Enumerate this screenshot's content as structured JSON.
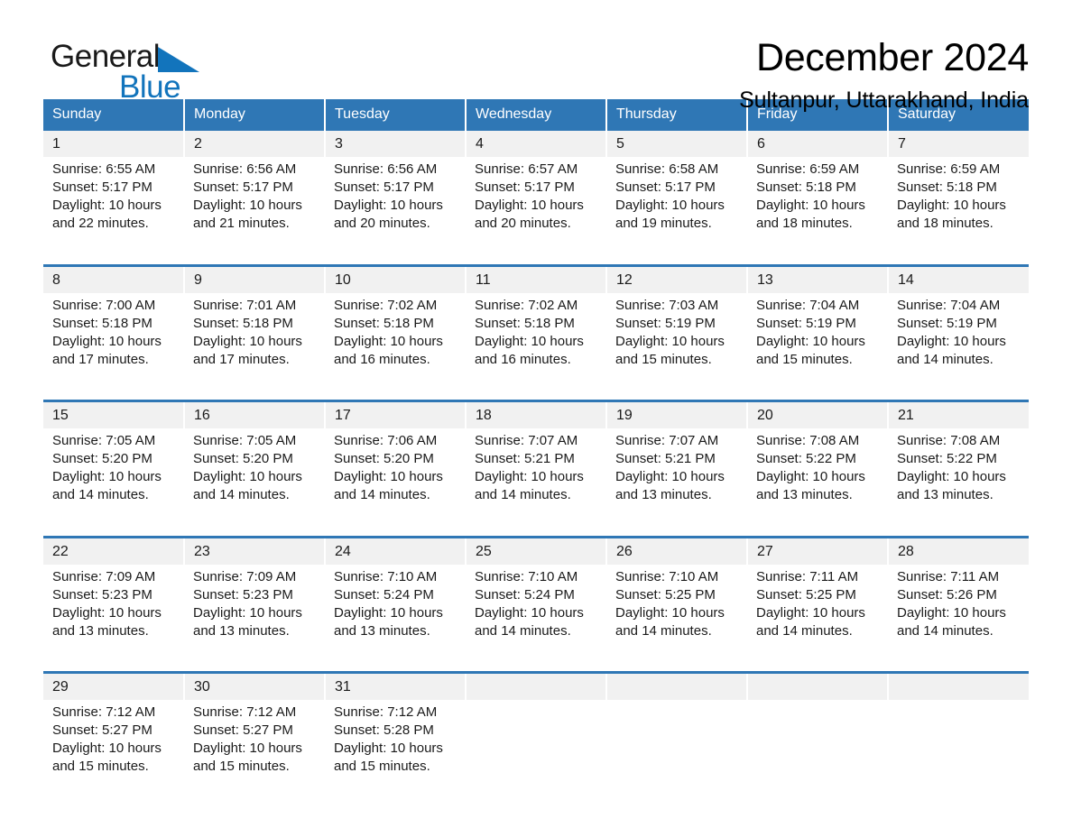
{
  "brand": {
    "word_one": "General",
    "word_two": "Blue",
    "triangle_color": "#1274bc"
  },
  "header": {
    "month_title": "December 2024",
    "location": "Sultanpur, Uttarakhand, India"
  },
  "colors": {
    "header_blue": "#2f77b5",
    "band_gray": "#f1f1f1",
    "accent_blue": "#1274bc"
  },
  "calendar": {
    "weekday_headers": [
      "Sunday",
      "Monday",
      "Tuesday",
      "Wednesday",
      "Thursday",
      "Friday",
      "Saturday"
    ],
    "weeks": [
      {
        "days": [
          {
            "date": "1",
            "sunrise": "Sunrise: 6:55 AM",
            "sunset": "Sunset: 5:17 PM",
            "daylight_1": "Daylight: 10 hours",
            "daylight_2": "and 22 minutes."
          },
          {
            "date": "2",
            "sunrise": "Sunrise: 6:56 AM",
            "sunset": "Sunset: 5:17 PM",
            "daylight_1": "Daylight: 10 hours",
            "daylight_2": "and 21 minutes."
          },
          {
            "date": "3",
            "sunrise": "Sunrise: 6:56 AM",
            "sunset": "Sunset: 5:17 PM",
            "daylight_1": "Daylight: 10 hours",
            "daylight_2": "and 20 minutes."
          },
          {
            "date": "4",
            "sunrise": "Sunrise: 6:57 AM",
            "sunset": "Sunset: 5:17 PM",
            "daylight_1": "Daylight: 10 hours",
            "daylight_2": "and 20 minutes."
          },
          {
            "date": "5",
            "sunrise": "Sunrise: 6:58 AM",
            "sunset": "Sunset: 5:17 PM",
            "daylight_1": "Daylight: 10 hours",
            "daylight_2": "and 19 minutes."
          },
          {
            "date": "6",
            "sunrise": "Sunrise: 6:59 AM",
            "sunset": "Sunset: 5:18 PM",
            "daylight_1": "Daylight: 10 hours",
            "daylight_2": "and 18 minutes."
          },
          {
            "date": "7",
            "sunrise": "Sunrise: 6:59 AM",
            "sunset": "Sunset: 5:18 PM",
            "daylight_1": "Daylight: 10 hours",
            "daylight_2": "and 18 minutes."
          }
        ]
      },
      {
        "days": [
          {
            "date": "8",
            "sunrise": "Sunrise: 7:00 AM",
            "sunset": "Sunset: 5:18 PM",
            "daylight_1": "Daylight: 10 hours",
            "daylight_2": "and 17 minutes."
          },
          {
            "date": "9",
            "sunrise": "Sunrise: 7:01 AM",
            "sunset": "Sunset: 5:18 PM",
            "daylight_1": "Daylight: 10 hours",
            "daylight_2": "and 17 minutes."
          },
          {
            "date": "10",
            "sunrise": "Sunrise: 7:02 AM",
            "sunset": "Sunset: 5:18 PM",
            "daylight_1": "Daylight: 10 hours",
            "daylight_2": "and 16 minutes."
          },
          {
            "date": "11",
            "sunrise": "Sunrise: 7:02 AM",
            "sunset": "Sunset: 5:18 PM",
            "daylight_1": "Daylight: 10 hours",
            "daylight_2": "and 16 minutes."
          },
          {
            "date": "12",
            "sunrise": "Sunrise: 7:03 AM",
            "sunset": "Sunset: 5:19 PM",
            "daylight_1": "Daylight: 10 hours",
            "daylight_2": "and 15 minutes."
          },
          {
            "date": "13",
            "sunrise": "Sunrise: 7:04 AM",
            "sunset": "Sunset: 5:19 PM",
            "daylight_1": "Daylight: 10 hours",
            "daylight_2": "and 15 minutes."
          },
          {
            "date": "14",
            "sunrise": "Sunrise: 7:04 AM",
            "sunset": "Sunset: 5:19 PM",
            "daylight_1": "Daylight: 10 hours",
            "daylight_2": "and 14 minutes."
          }
        ]
      },
      {
        "days": [
          {
            "date": "15",
            "sunrise": "Sunrise: 7:05 AM",
            "sunset": "Sunset: 5:20 PM",
            "daylight_1": "Daylight: 10 hours",
            "daylight_2": "and 14 minutes."
          },
          {
            "date": "16",
            "sunrise": "Sunrise: 7:05 AM",
            "sunset": "Sunset: 5:20 PM",
            "daylight_1": "Daylight: 10 hours",
            "daylight_2": "and 14 minutes."
          },
          {
            "date": "17",
            "sunrise": "Sunrise: 7:06 AM",
            "sunset": "Sunset: 5:20 PM",
            "daylight_1": "Daylight: 10 hours",
            "daylight_2": "and 14 minutes."
          },
          {
            "date": "18",
            "sunrise": "Sunrise: 7:07 AM",
            "sunset": "Sunset: 5:21 PM",
            "daylight_1": "Daylight: 10 hours",
            "daylight_2": "and 14 minutes."
          },
          {
            "date": "19",
            "sunrise": "Sunrise: 7:07 AM",
            "sunset": "Sunset: 5:21 PM",
            "daylight_1": "Daylight: 10 hours",
            "daylight_2": "and 13 minutes."
          },
          {
            "date": "20",
            "sunrise": "Sunrise: 7:08 AM",
            "sunset": "Sunset: 5:22 PM",
            "daylight_1": "Daylight: 10 hours",
            "daylight_2": "and 13 minutes."
          },
          {
            "date": "21",
            "sunrise": "Sunrise: 7:08 AM",
            "sunset": "Sunset: 5:22 PM",
            "daylight_1": "Daylight: 10 hours",
            "daylight_2": "and 13 minutes."
          }
        ]
      },
      {
        "days": [
          {
            "date": "22",
            "sunrise": "Sunrise: 7:09 AM",
            "sunset": "Sunset: 5:23 PM",
            "daylight_1": "Daylight: 10 hours",
            "daylight_2": "and 13 minutes."
          },
          {
            "date": "23",
            "sunrise": "Sunrise: 7:09 AM",
            "sunset": "Sunset: 5:23 PM",
            "daylight_1": "Daylight: 10 hours",
            "daylight_2": "and 13 minutes."
          },
          {
            "date": "24",
            "sunrise": "Sunrise: 7:10 AM",
            "sunset": "Sunset: 5:24 PM",
            "daylight_1": "Daylight: 10 hours",
            "daylight_2": "and 13 minutes."
          },
          {
            "date": "25",
            "sunrise": "Sunrise: 7:10 AM",
            "sunset": "Sunset: 5:24 PM",
            "daylight_1": "Daylight: 10 hours",
            "daylight_2": "and 14 minutes."
          },
          {
            "date": "26",
            "sunrise": "Sunrise: 7:10 AM",
            "sunset": "Sunset: 5:25 PM",
            "daylight_1": "Daylight: 10 hours",
            "daylight_2": "and 14 minutes."
          },
          {
            "date": "27",
            "sunrise": "Sunrise: 7:11 AM",
            "sunset": "Sunset: 5:25 PM",
            "daylight_1": "Daylight: 10 hours",
            "daylight_2": "and 14 minutes."
          },
          {
            "date": "28",
            "sunrise": "Sunrise: 7:11 AM",
            "sunset": "Sunset: 5:26 PM",
            "daylight_1": "Daylight: 10 hours",
            "daylight_2": "and 14 minutes."
          }
        ]
      },
      {
        "days": [
          {
            "date": "29",
            "sunrise": "Sunrise: 7:12 AM",
            "sunset": "Sunset: 5:27 PM",
            "daylight_1": "Daylight: 10 hours",
            "daylight_2": "and 15 minutes."
          },
          {
            "date": "30",
            "sunrise": "Sunrise: 7:12 AM",
            "sunset": "Sunset: 5:27 PM",
            "daylight_1": "Daylight: 10 hours",
            "daylight_2": "and 15 minutes."
          },
          {
            "date": "31",
            "sunrise": "Sunrise: 7:12 AM",
            "sunset": "Sunset: 5:28 PM",
            "daylight_1": "Daylight: 10 hours",
            "daylight_2": "and 15 minutes."
          },
          {
            "date": "",
            "sunrise": "",
            "sunset": "",
            "daylight_1": "",
            "daylight_2": ""
          },
          {
            "date": "",
            "sunrise": "",
            "sunset": "",
            "daylight_1": "",
            "daylight_2": ""
          },
          {
            "date": "",
            "sunrise": "",
            "sunset": "",
            "daylight_1": "",
            "daylight_2": ""
          },
          {
            "date": "",
            "sunrise": "",
            "sunset": "",
            "daylight_1": "",
            "daylight_2": ""
          }
        ]
      }
    ]
  }
}
